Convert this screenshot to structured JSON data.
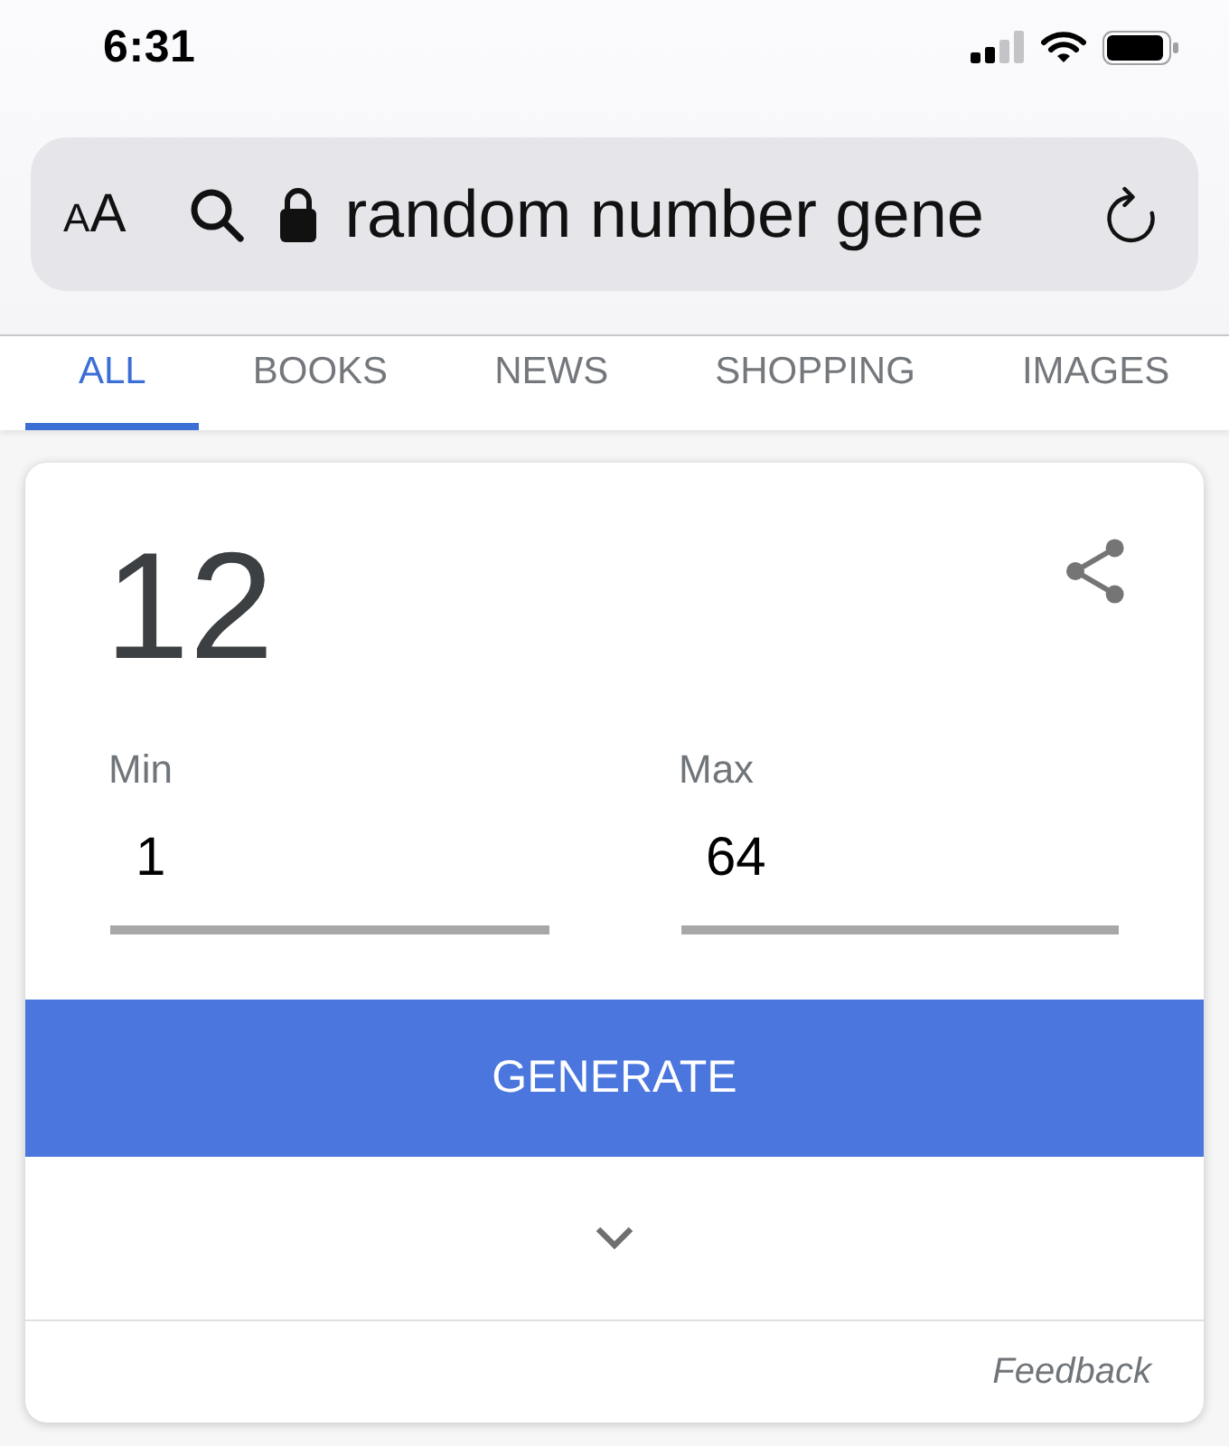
{
  "status_bar": {
    "time": "6:31"
  },
  "address_bar": {
    "text_size_button": "AA",
    "url": "random number gene"
  },
  "tabs": [
    {
      "label": "ALL",
      "selected": true
    },
    {
      "label": "BOOKS",
      "selected": false
    },
    {
      "label": "NEWS",
      "selected": false
    },
    {
      "label": "SHOPPING",
      "selected": false
    },
    {
      "label": "IMAGES",
      "selected": false
    }
  ],
  "generator": {
    "result": "12",
    "fields": [
      {
        "label": "Min",
        "value": "1"
      },
      {
        "label": "Max",
        "value": "64"
      }
    ],
    "button": "GENERATE",
    "footer_link": "Feedback"
  }
}
